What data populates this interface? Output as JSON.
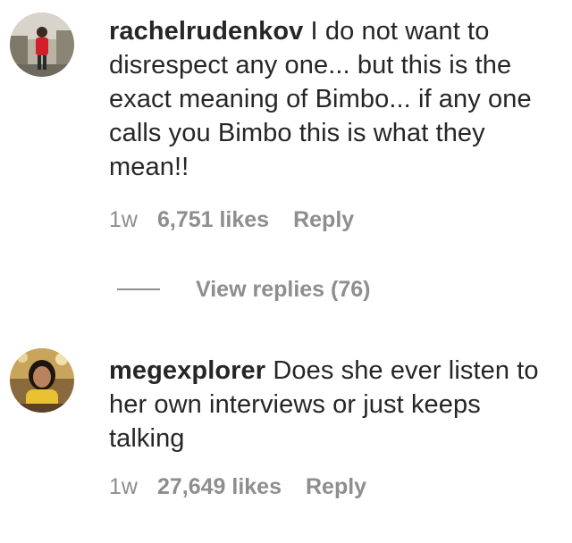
{
  "comments": [
    {
      "username": "rachelrudenkov",
      "text": "I do not want to disrespect any one... but this is the exact meaning of Bimbo... if any one calls you Bimbo this is what they mean!!",
      "time": "1w",
      "likes": "6,751 likes",
      "reply_label": "Reply",
      "view_replies": "View replies (76)"
    },
    {
      "username": "megexplorer",
      "text": "Does she ever listen to her own interviews or just keeps talking",
      "time": "1w",
      "likes": "27,649 likes",
      "reply_label": "Reply"
    }
  ],
  "colors": {
    "text": "#262626",
    "secondary": "#8e8e8e",
    "background": "#ffffff"
  }
}
